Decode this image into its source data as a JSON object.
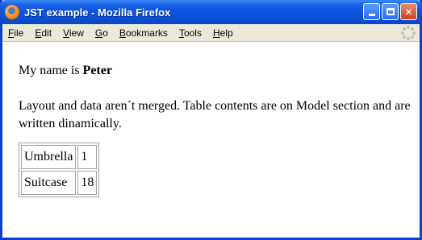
{
  "window": {
    "title": "JST example - Mozilla Firefox"
  },
  "menu": {
    "items": [
      {
        "accel": "F",
        "rest": "ile"
      },
      {
        "accel": "E",
        "rest": "dit"
      },
      {
        "accel": "V",
        "rest": "iew"
      },
      {
        "accel": "G",
        "rest": "o"
      },
      {
        "accel": "B",
        "rest": "ookmarks"
      },
      {
        "accel": "T",
        "rest": "ools"
      },
      {
        "accel": "H",
        "rest": "elp"
      }
    ]
  },
  "page": {
    "greeting_prefix": "My name is ",
    "name": "Peter",
    "description": "Layout and data aren´t merged. Table contents are on Model section and are written dinamically.",
    "table": {
      "rows": [
        {
          "item": "Umbrella",
          "qty": "1"
        },
        {
          "item": "Suitcase",
          "qty": "18"
        }
      ]
    }
  },
  "icons": {
    "app": "firefox-icon",
    "minimize": "minimize-icon",
    "maximize": "maximize-icon",
    "close": "close-icon",
    "throbber": "throbber-icon"
  }
}
